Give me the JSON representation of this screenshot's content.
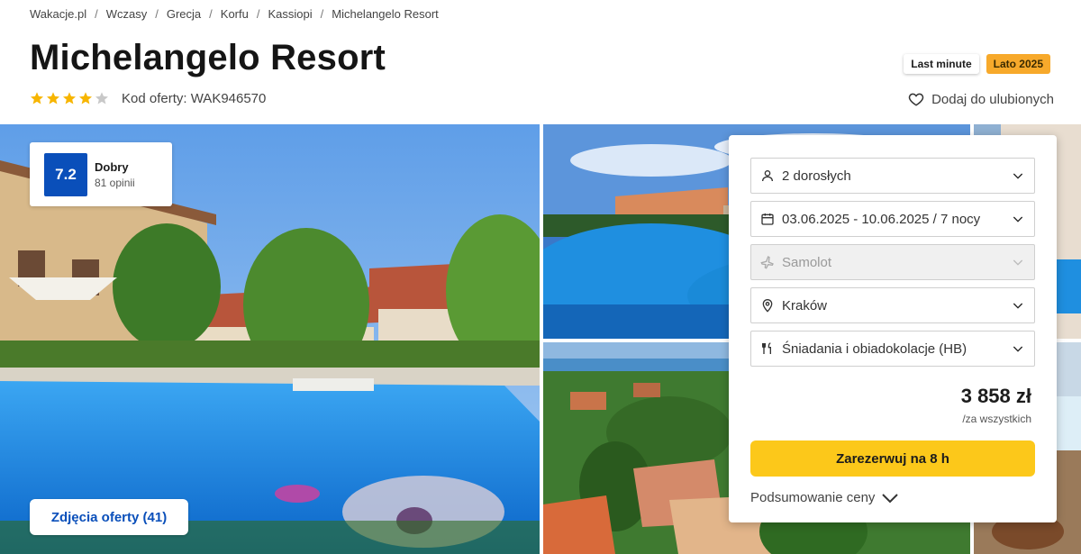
{
  "breadcrumb": [
    "Wakacje.pl",
    "Wczasy",
    "Grecja",
    "Korfu",
    "Kassiopi",
    "Michelangelo Resort"
  ],
  "hotel": {
    "name": "Michelangelo Resort",
    "stars": 4,
    "stars_max": 5,
    "offer_code": "Kod oferty: WAK946570"
  },
  "badges": {
    "last_minute": "Last minute",
    "season": "Lato 2025"
  },
  "favorite_label": "Dodaj do ulubionych",
  "rating": {
    "score": "7.2",
    "label": "Dobry",
    "count": "81 opinii"
  },
  "photos_button": "Zdjęcia oferty (41)",
  "booking": {
    "guests": "2 dorosłych",
    "dates": "03.06.2025 - 10.06.2025 / 7 nocy",
    "transport": "Samolot",
    "departure": "Kraków",
    "board": "Śniadania i obiadokolacje (HB)",
    "price": "3 858 zł",
    "price_note": "/za wszystkich",
    "reserve_label": "Zarezerwuj na 8 h",
    "summary_label": "Podsumowanie ceny"
  },
  "colors": {
    "accent_blue": "#0a4fba",
    "cta_yellow": "#fcc81a",
    "season_orange": "#f7a92b",
    "star_yellow": "#f7b500"
  },
  "icons": [
    "star-icon",
    "heart-icon",
    "person-icon",
    "calendar-icon",
    "plane-icon",
    "location-pin-icon",
    "cutlery-icon",
    "chevron-down-icon"
  ]
}
